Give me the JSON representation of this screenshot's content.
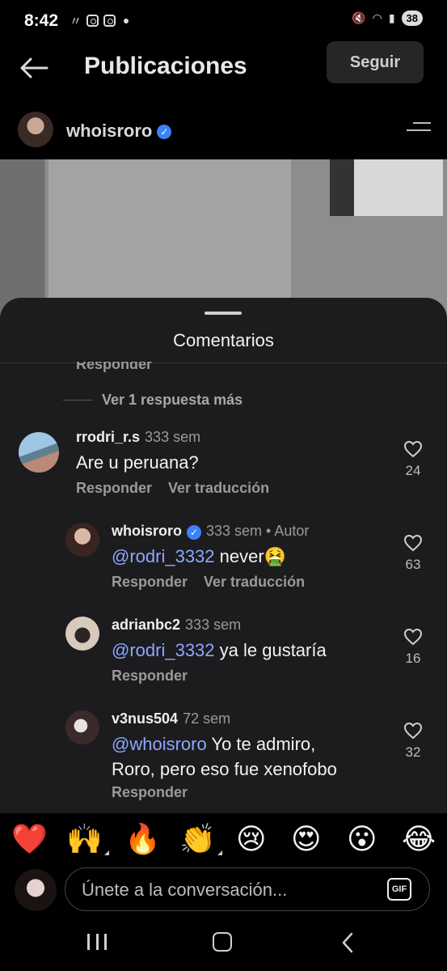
{
  "status_bar": {
    "time": "8:42",
    "battery": "38"
  },
  "header": {
    "title": "Publicaciones",
    "follow_label": "Seguir"
  },
  "author": {
    "username": "whoisroro"
  },
  "comments_sheet": {
    "title": "Comentarios",
    "cut_reply_label": "Responder",
    "more_replies_label": "Ver 1 respuesta más",
    "comments": [
      {
        "username": "rrodri_r.s",
        "time": "333 sem",
        "text": "Are u peruana?",
        "likes": "24",
        "reply_label": "Responder",
        "translate_label": "Ver traducción"
      },
      {
        "username": "whoisroro",
        "time": "333 sem • Autor",
        "mention": "@rodri_3332",
        "text": " never🤮",
        "likes": "63",
        "reply_label": "Responder",
        "translate_label": "Ver traducción"
      },
      {
        "username": "adrianbc2",
        "time": "333 sem",
        "mention": "@rodri_3332",
        "text": " ya le gustaría",
        "likes": "16",
        "reply_label": "Responder"
      },
      {
        "username": "v3nus504",
        "time": "72 sem",
        "mention": "@whoisroro",
        "text": " Yo te admiro, Roro, pero eso fue xenofobo",
        "likes": "32",
        "reply_label": "Responder"
      }
    ]
  },
  "emoji_reactions": [
    "❤️",
    "🙌",
    "🔥",
    "👏",
    "😢",
    "😍",
    "😮",
    "😂"
  ],
  "composer": {
    "placeholder": "Únete a la conversación...",
    "gif_label": "GIF"
  }
}
